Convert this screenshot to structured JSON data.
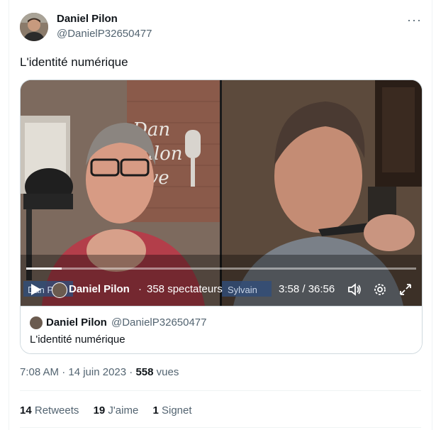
{
  "author": {
    "name": "Daniel Pilon",
    "handle": "@DanielP32650477"
  },
  "tweet": {
    "text": "L'identité numérique"
  },
  "video": {
    "host_name": "Daniel Pilon",
    "separator": "·",
    "viewers": "358 spectateurs",
    "time": "3:58 / 36:56",
    "progress": 0.09,
    "watermark_left": "Dan Pilon",
    "watermark_right": "Sylvain",
    "sign_text": [
      "Dan",
      "Pilon",
      "Live"
    ]
  },
  "quoted": {
    "name": "Daniel Pilon",
    "handle": "@DanielP32650477",
    "text": "L'identité numérique"
  },
  "meta": {
    "time": "7:08 AM · 14 juin 2023 · ",
    "views": "558",
    "views_label": " vues"
  },
  "stats": {
    "retweets": "14",
    "retweets_label": " Retweets",
    "likes": "19",
    "likes_label": " J'aime",
    "bookmarks": "1",
    "bookmarks_label": " Signet"
  },
  "more_label": "···",
  "colors": {
    "text": "#0f1419",
    "secondary": "#536471",
    "border": "#cfd9de"
  }
}
